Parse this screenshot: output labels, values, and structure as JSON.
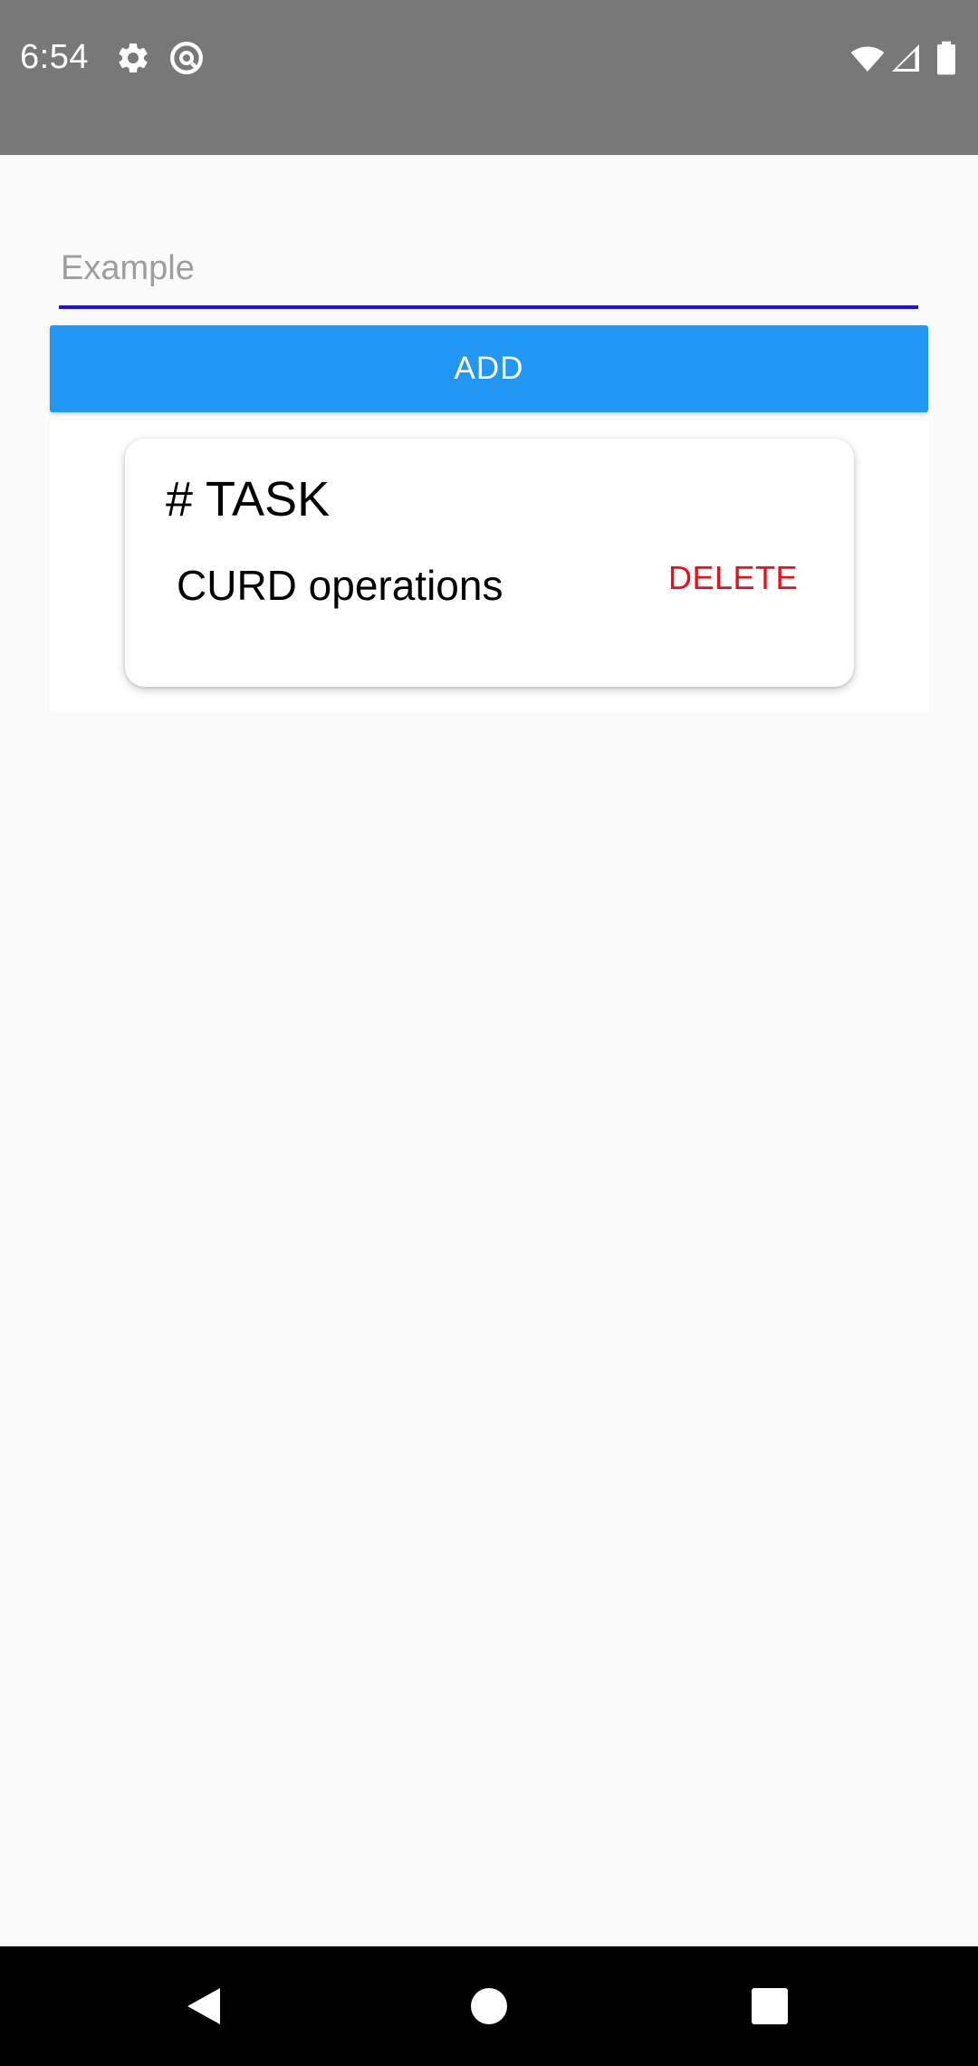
{
  "status_bar": {
    "time": "6:54",
    "left_icons": [
      "gear-icon",
      "at-sign-icon"
    ],
    "right_icons": [
      "wifi-icon",
      "signal-icon",
      "battery-icon"
    ],
    "background_color": "#787878"
  },
  "form": {
    "input": {
      "value": "",
      "placeholder": "Example",
      "underline_color": "#1a10e0"
    },
    "add_button": {
      "label": "ADD",
      "color": "#2196f3"
    }
  },
  "task_card": {
    "heading": "# TASK",
    "task_text": "CURD operations",
    "delete_label": "DELETE",
    "delete_color": "#e8111b"
  },
  "nav_bar": {
    "buttons": [
      "back-icon",
      "home-icon",
      "recents-icon"
    ]
  }
}
